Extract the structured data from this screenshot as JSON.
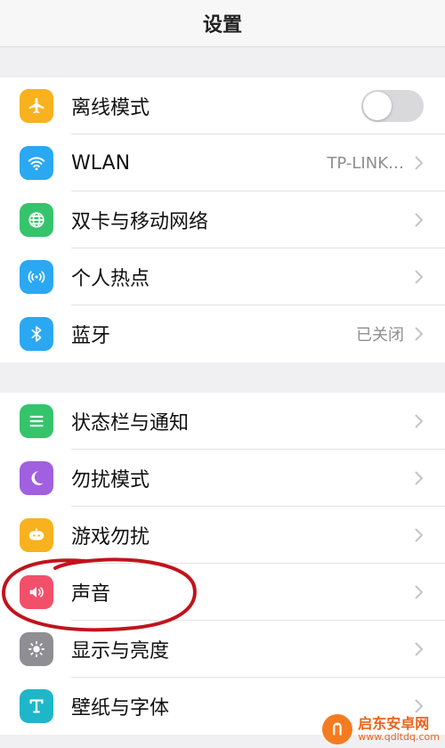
{
  "header": {
    "title": "设置"
  },
  "groups": [
    {
      "items": [
        {
          "label": "离线模式",
          "icon": "airplane-icon",
          "icon_color": "#f8b21f",
          "control": "toggle",
          "toggle_on": false
        },
        {
          "label": "WLAN",
          "icon": "wifi-icon",
          "icon_color": "#2aa8f2",
          "value": "TP-LINK…"
        },
        {
          "label": "双卡与移动网络",
          "icon": "globe-icon",
          "icon_color": "#35c46b"
        },
        {
          "label": "个人热点",
          "icon": "hotspot-icon",
          "icon_color": "#2aa8f2"
        },
        {
          "label": "蓝牙",
          "icon": "bluetooth-icon",
          "icon_color": "#2aa8f2",
          "value": "已关闭"
        }
      ]
    },
    {
      "items": [
        {
          "label": "状态栏与通知",
          "icon": "notification-bar-icon",
          "icon_color": "#35c46b"
        },
        {
          "label": "勿扰模式",
          "icon": "moon-icon",
          "icon_color": "#a160e0"
        },
        {
          "label": "游戏勿扰",
          "icon": "gamepad-icon",
          "icon_color": "#f8b21f"
        },
        {
          "label": "声音",
          "icon": "speaker-icon",
          "icon_color": "#f2506a"
        },
        {
          "label": "显示与亮度",
          "icon": "brightness-icon",
          "icon_color": "#8e8e93"
        },
        {
          "label": "壁纸与字体",
          "icon": "wallpaper-font-icon",
          "icon_color": "#1fb6c9"
        }
      ]
    }
  ],
  "watermark": {
    "title": "启东安卓网",
    "url": "www.qdltdq.com"
  }
}
